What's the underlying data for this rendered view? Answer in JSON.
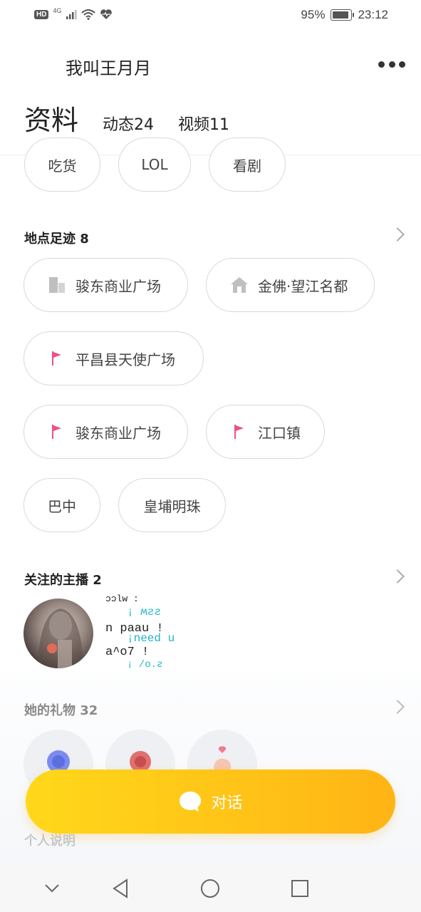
{
  "status_bar": {
    "hd": "HD",
    "network": "4G",
    "battery_percent": "95%",
    "time": "23:12"
  },
  "header": {
    "title": "我叫王月月",
    "more_icon": "more-horizontal-icon"
  },
  "tabs": [
    {
      "label": "资料",
      "active": true
    },
    {
      "label": "动态24",
      "active": false
    },
    {
      "label": "视频11",
      "active": false
    }
  ],
  "interests": [
    "吃货",
    "LOL",
    "看剧"
  ],
  "footprints": {
    "title": "地点足迹 8",
    "items": [
      {
        "label": "骏东商业广场",
        "icon": "building-icon"
      },
      {
        "label": "金佛·望江名都",
        "icon": "house-icon"
      },
      {
        "label": "平昌县天使广场",
        "icon": "flag-icon"
      },
      {
        "label": "骏东商业广场",
        "icon": "flag-icon"
      },
      {
        "label": "江口镇",
        "icon": "flag-icon"
      },
      {
        "label": "巴中",
        "icon": ""
      },
      {
        "label": "皇埔明珠",
        "icon": ""
      }
    ]
  },
  "following": {
    "title": "关注的主播 2",
    "anchor2_lines": [
      "ɔɔlw :",
      "¡ ʍƨƨ",
      "n paau !",
      "¡need u",
      "a^o7 !",
      "¡ /o.ƨ"
    ]
  },
  "gifts": {
    "title": "她的礼物 32",
    "items": [
      "blue-rose-icon",
      "red-rose-icon",
      "finger-heart-icon"
    ]
  },
  "chat_button": {
    "label": "对话"
  },
  "description_label": "个人说明",
  "colors": {
    "accent_start": "#ffd81a",
    "accent_end": "#ffb415",
    "flag": "#ee4f8a"
  }
}
